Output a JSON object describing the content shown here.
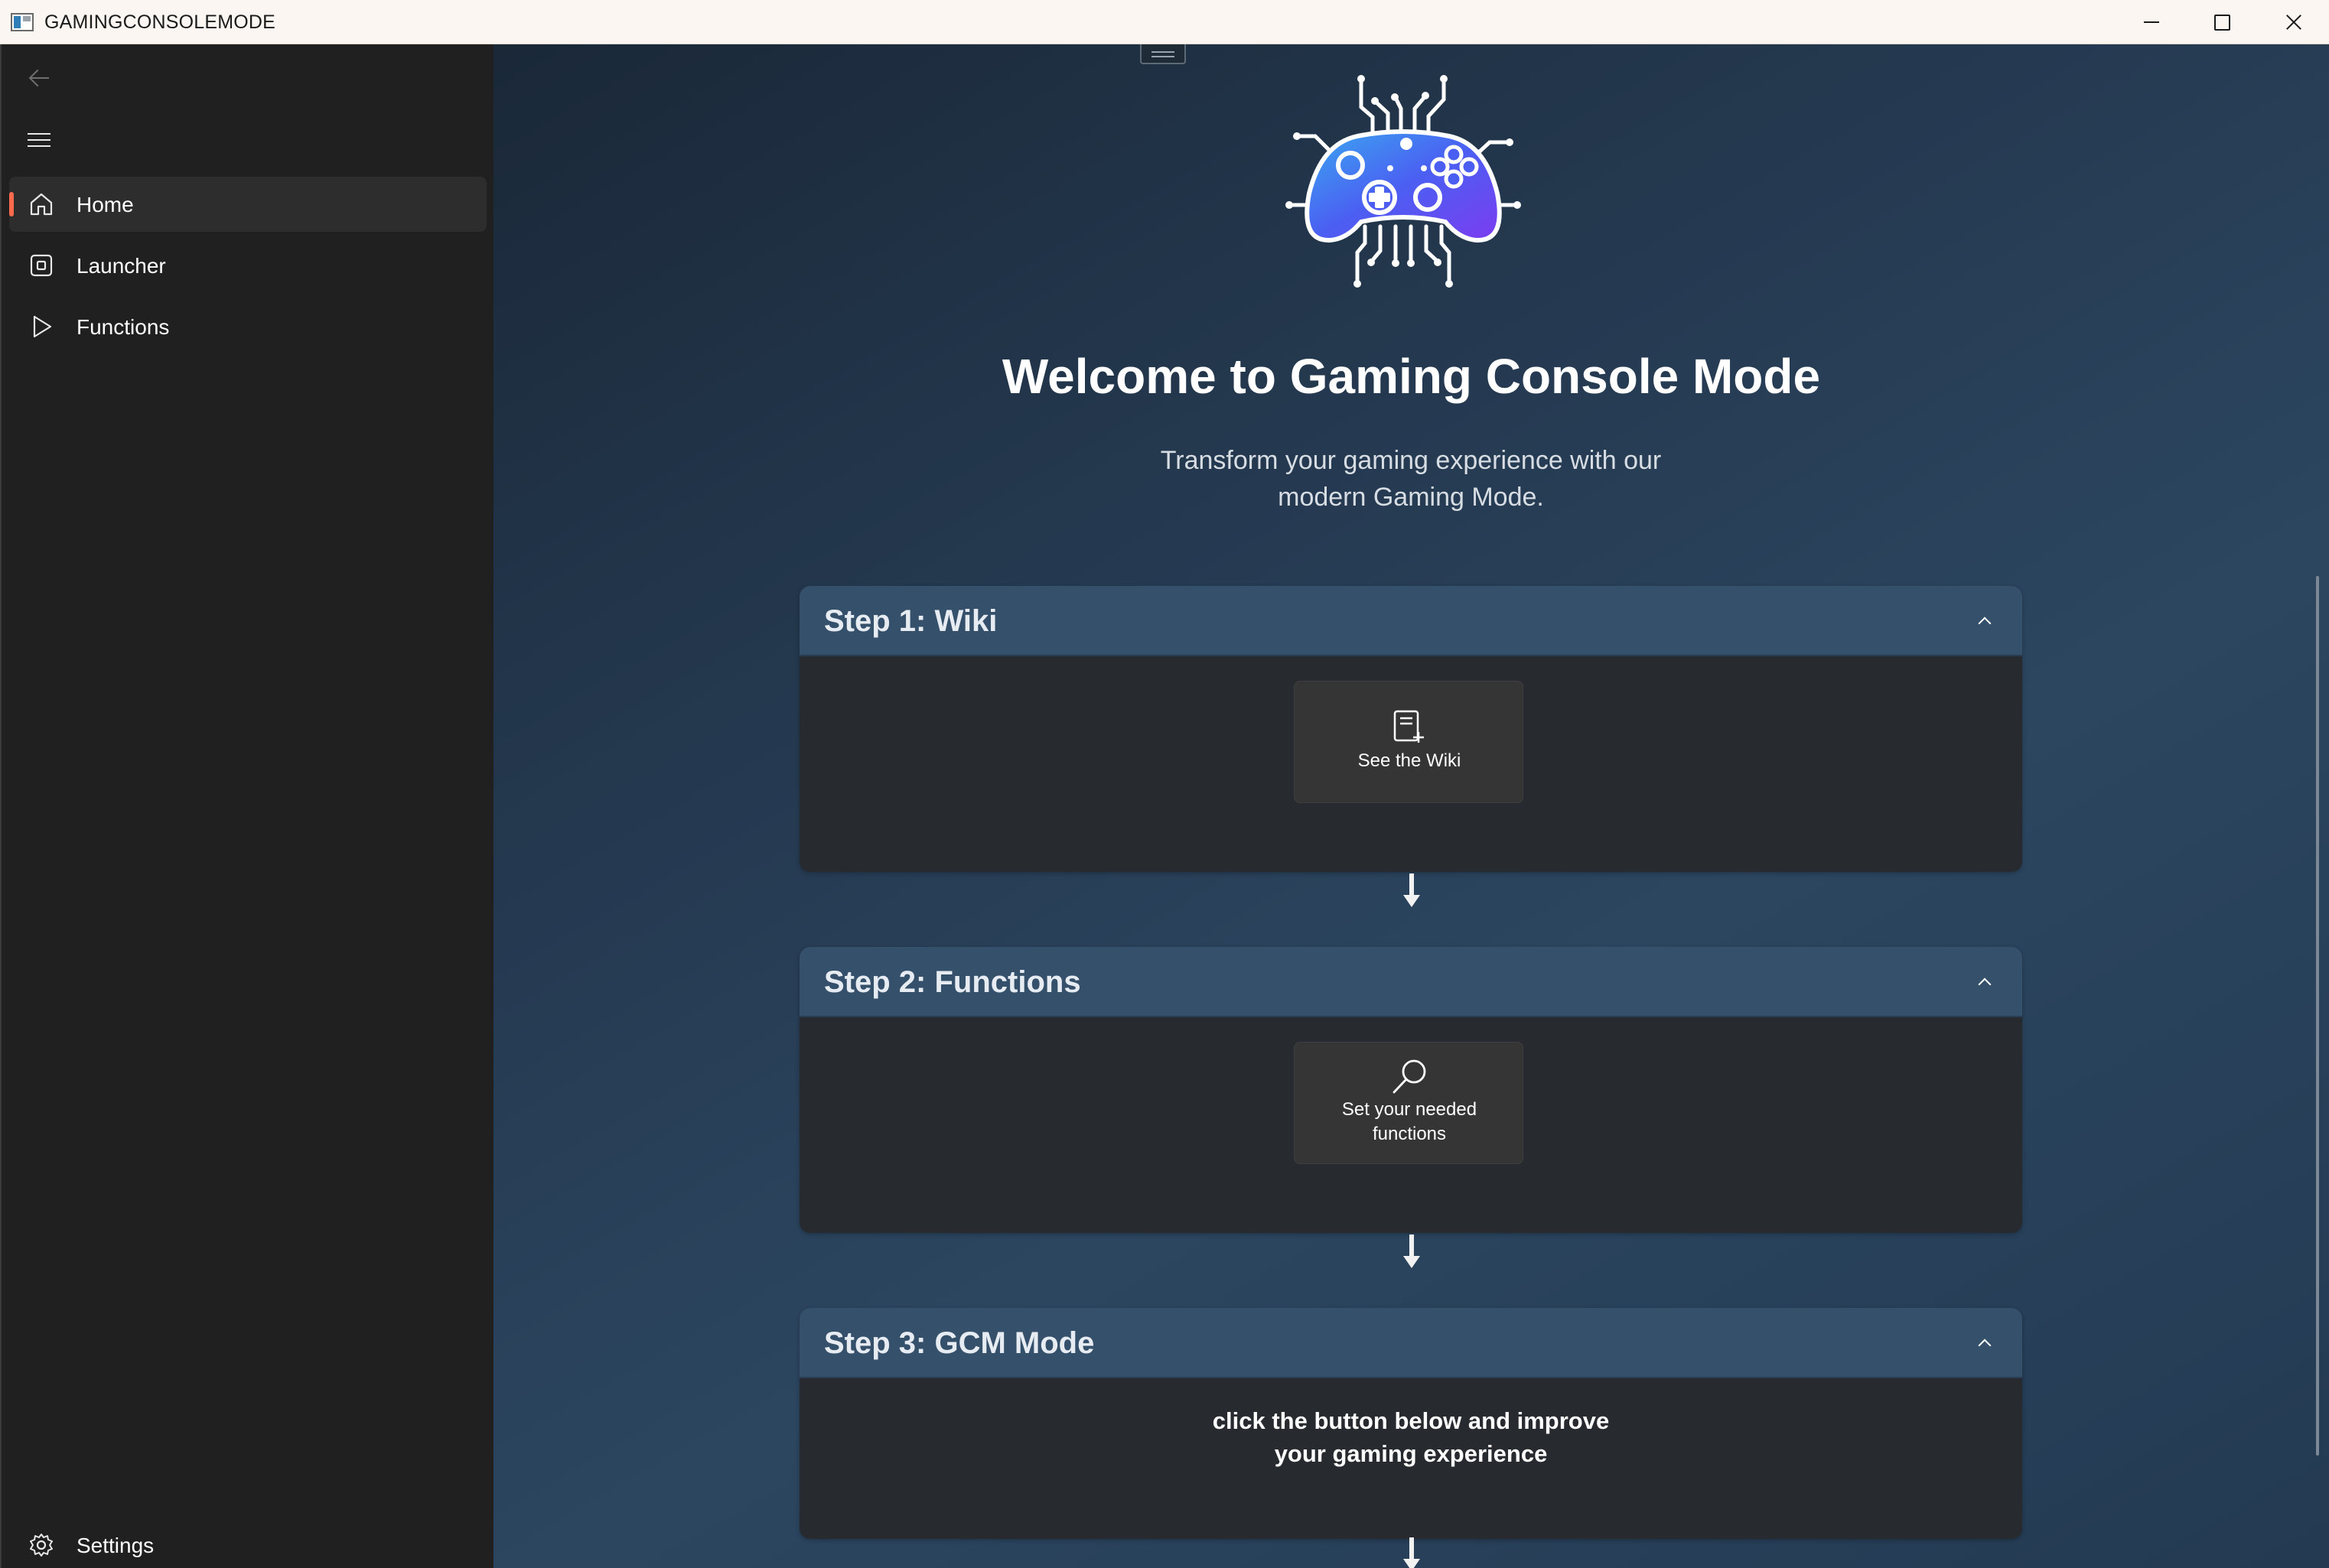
{
  "window": {
    "title": "GAMINGCONSOLEMODE"
  },
  "sidebar": {
    "items": [
      {
        "label": "Home",
        "icon": "home-icon",
        "selected": true
      },
      {
        "label": "Launcher",
        "icon": "launcher-icon",
        "selected": false
      },
      {
        "label": "Functions",
        "icon": "play-icon",
        "selected": false
      }
    ],
    "settings_label": "Settings",
    "accent_color": "#ff6a4d"
  },
  "main": {
    "title": "Welcome to Gaming Console Mode",
    "subtitle_line1": "Transform your gaming experience with our",
    "subtitle_line2": "modern Gaming Mode.",
    "steps": [
      {
        "title": "Step 1: Wiki",
        "button_label": "See the Wiki",
        "button_icon": "wiki-icon"
      },
      {
        "title": "Step 2: Functions",
        "button_label_line1": "Set your needed",
        "button_label_line2": "functions",
        "button_icon": "search-icon"
      },
      {
        "title": "Step 3: GCM Mode",
        "text_line1": "click the button below and improve",
        "text_line2": "your gaming experience"
      }
    ]
  }
}
